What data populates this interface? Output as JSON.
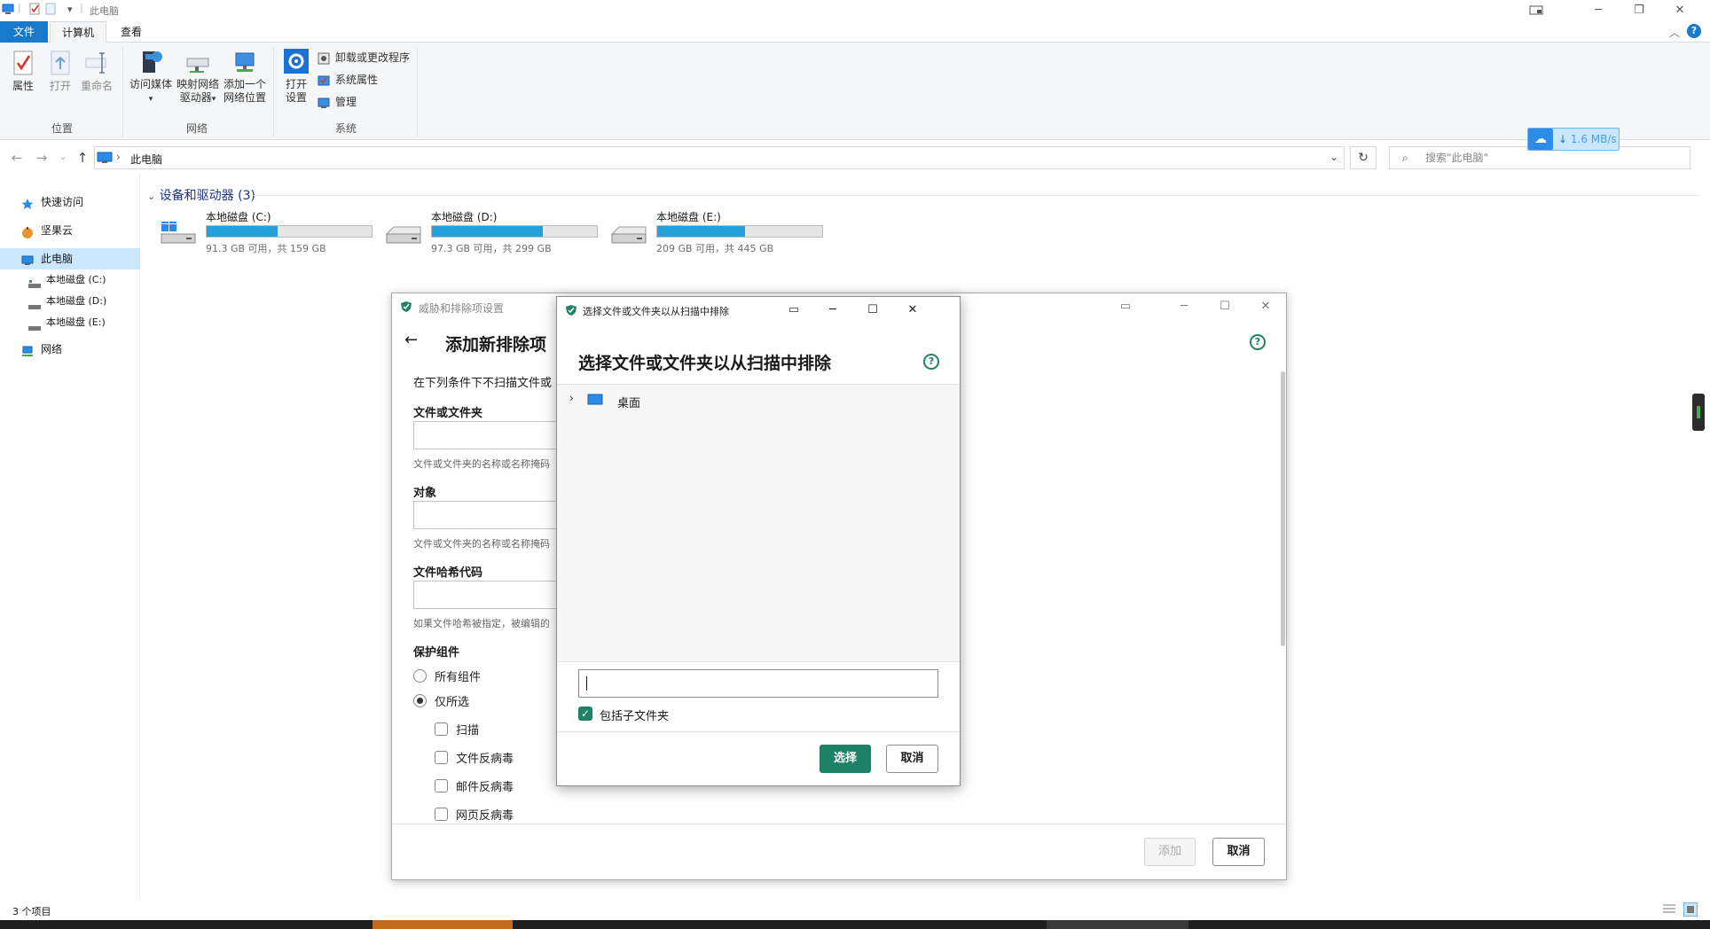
{
  "window": {
    "title": "此电脑",
    "controls": [
      "min",
      "max",
      "close"
    ]
  },
  "ribbon": {
    "tabs": [
      {
        "label": "文件",
        "active": false,
        "color": "#1979ca"
      },
      {
        "label": "计算机",
        "active": true
      },
      {
        "label": "查看",
        "active": false
      }
    ],
    "groups": [
      {
        "label": "位置",
        "buttons": [
          "属性",
          "打开",
          "重命名"
        ]
      },
      {
        "label": "网络",
        "buttons": [
          "访问媒体",
          "映射网络\n驱动器",
          "添加一个\n网络位置"
        ]
      },
      {
        "label": "系统",
        "buttons": [
          "打开\n设置"
        ],
        "small_buttons": [
          "卸载或更改程序",
          "系统属性",
          "管理"
        ]
      }
    ],
    "btn_access_media": "访问媒体",
    "btn_map_drive_1": "映射网络",
    "btn_map_drive_2": "驱动器",
    "btn_add_location_1": "添加一个",
    "btn_add_location_2": "网络位置",
    "btn_open_settings_1": "打开",
    "btn_open_settings_2": "设置"
  },
  "address": {
    "path": "此电脑",
    "search_placeholder": "搜索\"此电脑\"",
    "speed_badge": "1.6 MB/s"
  },
  "navpane": {
    "items": [
      {
        "label": "快速访问",
        "icon": "star-icon"
      },
      {
        "label": "坚果云",
        "icon": "nutstore-icon"
      },
      {
        "label": "此电脑",
        "icon": "computer-icon",
        "selected": true
      },
      {
        "label": "本地磁盘 (C:)",
        "icon": "drive-icon",
        "sub": true
      },
      {
        "label": "本地磁盘 (D:)",
        "icon": "drive-icon",
        "sub": true
      },
      {
        "label": "本地磁盘 (E:)",
        "icon": "drive-icon",
        "sub": true
      },
      {
        "label": "网络",
        "icon": "network-icon"
      }
    ]
  },
  "content": {
    "group_header": "设备和驱动器 (3)",
    "drives": [
      {
        "name": "本地磁盘 (C:)",
        "free": "91.3 GB 可用，共 159 GB",
        "used_fraction": 0.43
      },
      {
        "name": "本地磁盘 (D:)",
        "free": "97.3 GB 可用，共 299 GB",
        "used_fraction": 0.67
      },
      {
        "name": "本地磁盘 (E:)",
        "free": "209 GB 可用，共 445 GB",
        "used_fraction": 0.53
      }
    ]
  },
  "status": {
    "item_count": "3 个项目"
  },
  "dialog_back": {
    "window_title": "威胁和排除项设置",
    "heading": "添加新排除项",
    "intro": "在下列条件下不扫描文件或",
    "field_file_label": "文件或文件夹",
    "field_file_hint": "文件或文件夹的名称或名称掩码",
    "field_object_label": "对象",
    "field_object_hint": "文件或文件夹的名称或名称掩码",
    "field_hash_label": "文件哈希代码",
    "field_hash_hint": "如果文件哈希被指定，被编辑的",
    "components_label": "保护组件",
    "radio_all": "所有组件",
    "radio_selected": "仅所选",
    "checkboxes": [
      "扫描",
      "文件反病毒",
      "邮件反病毒",
      "网页反病毒"
    ],
    "add_button": "添加",
    "cancel_button": "取消"
  },
  "dialog_front": {
    "window_title": "选择文件或文件夹以从扫描中排除",
    "heading": "选择文件或文件夹以从扫描中排除",
    "tree_item": "桌面",
    "path_value": "",
    "include_subfolders": "包括子文件夹",
    "select_button": "选择",
    "cancel_button": "取消",
    "accent_color": "#1f8165"
  }
}
